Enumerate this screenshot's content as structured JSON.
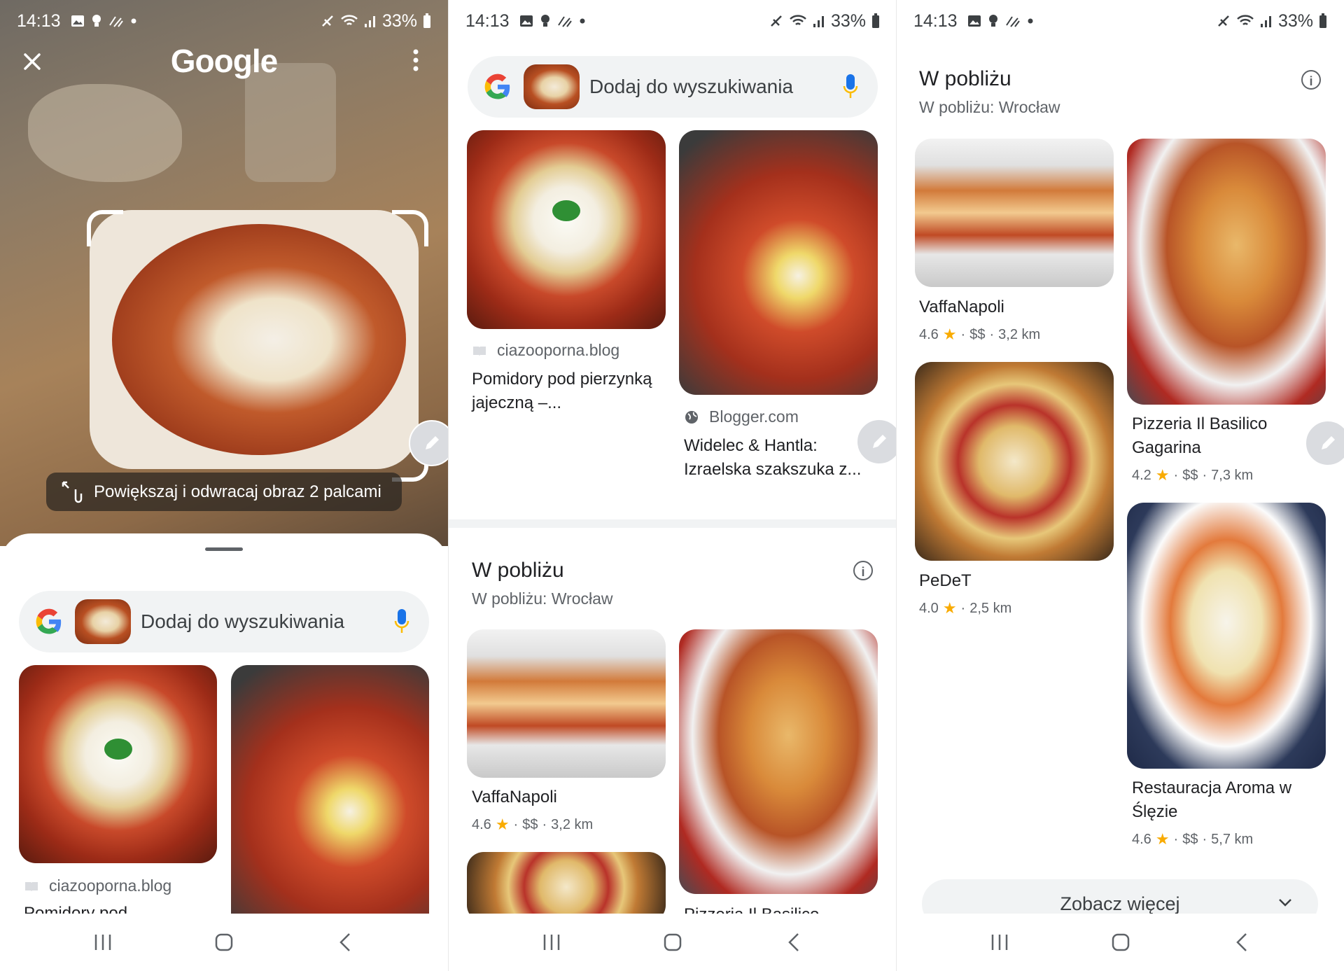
{
  "status_bar": {
    "time": "14:13",
    "battery": "33%"
  },
  "panel1": {
    "app_title": "Google",
    "gesture_hint": "Powiększaj i odwracaj obraz 2 palcami",
    "search_placeholder": "Dodaj do wyszukiwania",
    "results": [
      {
        "source": "ciazooporna.blog",
        "title": "Pomidory pod"
      }
    ]
  },
  "panel2": {
    "search_placeholder": "Dodaj do wyszukiwania",
    "results": [
      {
        "source": "ciazooporna.blog",
        "title": "Pomidory pod pierzynką jajeczną –..."
      },
      {
        "source": "Blogger.com",
        "title": "Widelec & Hantla: Izraelska szakszuka z..."
      }
    ],
    "nearby": {
      "title": "W pobliżu",
      "subtitle": "W pobliżu: Wrocław",
      "places": [
        {
          "name": "VaffaNapoli",
          "rating": "4.6",
          "price": "$$",
          "distance": "3,2 km"
        },
        {
          "name": "Pizzeria Il Basilico"
        }
      ]
    }
  },
  "panel3": {
    "nearby": {
      "title": "W pobliżu",
      "subtitle": "W pobliżu: Wrocław",
      "places": [
        {
          "name": "VaffaNapoli",
          "rating": "4.6",
          "price": "$$",
          "distance": "3,2 km"
        },
        {
          "name": "Pizzeria Il Basilico Gagarina",
          "rating": "4.2",
          "price": "$$",
          "distance": "7,3 km"
        },
        {
          "name": "PeDeT",
          "rating": "4.0",
          "distance": "2,5 km"
        },
        {
          "name": "Restauracja Aroma w Ślęzie",
          "rating": "4.6",
          "price": "$$",
          "distance": "5,7 km"
        }
      ]
    },
    "more_button": "Zobacz więcej"
  },
  "icons": {
    "star": "★",
    "dot_sep": "·"
  },
  "colors": {
    "star": "#f9ab00",
    "search_bg": "#f1f3f4",
    "mic_blue": "#1a73e8"
  }
}
